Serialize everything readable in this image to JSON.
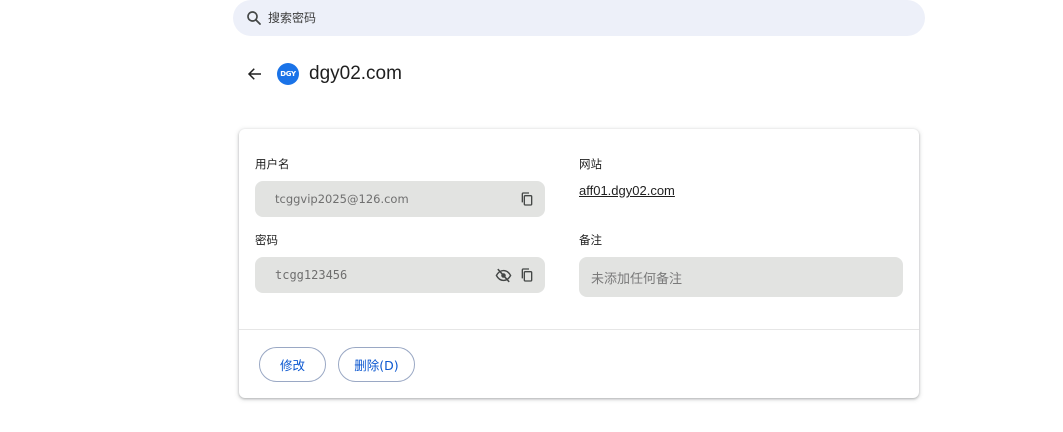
{
  "search": {
    "placeholder": "搜索密码",
    "icon": "search-icon"
  },
  "header": {
    "back_icon": "arrow-left-icon",
    "logo_text": "DGY",
    "logo_color": "#1a73e8",
    "title": "dgy02.com"
  },
  "details": {
    "username": {
      "label": "用户名",
      "value": "tcggvip2025@126.com",
      "copy_icon": "copy-icon"
    },
    "password": {
      "label": "密码",
      "value": "tcgg123456",
      "toggle_icon": "eye-off-icon",
      "copy_icon": "copy-icon"
    },
    "website": {
      "label": "网站",
      "value": "aff01.dgy02.com"
    },
    "notes": {
      "label": "备注",
      "placeholder": "未添加任何备注"
    }
  },
  "actions": {
    "edit_label": "修改",
    "delete_label": "删除(D)"
  },
  "colors": {
    "accent": "#0b57d0",
    "field_bg": "#e2e3e1",
    "search_bg": "#edf0f9"
  }
}
